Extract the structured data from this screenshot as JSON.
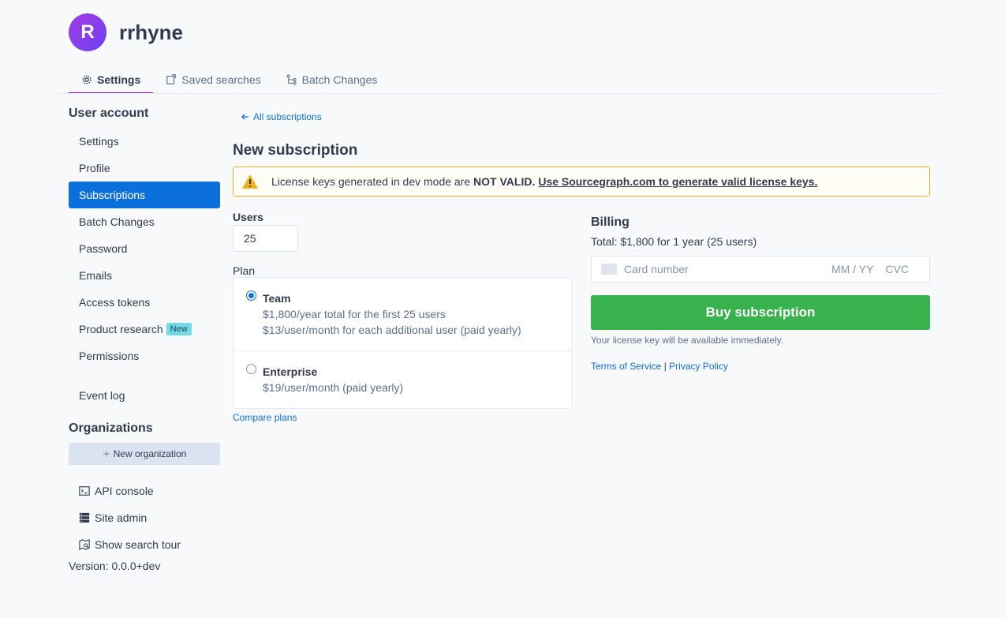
{
  "header": {
    "avatar_initial": "R",
    "username": "rrhyne"
  },
  "tabs": [
    {
      "label": "Settings",
      "icon": "gear-icon",
      "active": true
    },
    {
      "label": "Saved searches",
      "icon": "saved-search-icon"
    },
    {
      "label": "Batch Changes",
      "icon": "batch-changes-icon"
    }
  ],
  "sidebar": {
    "heading": "User account",
    "items": [
      {
        "label": "Settings"
      },
      {
        "label": "Profile"
      },
      {
        "label": "Subscriptions",
        "active": true
      },
      {
        "label": "Batch Changes"
      },
      {
        "label": "Password"
      },
      {
        "label": "Emails"
      },
      {
        "label": "Access tokens"
      },
      {
        "label": "Product research",
        "badge": "New"
      },
      {
        "label": "Permissions"
      },
      {
        "label": "Event log"
      }
    ],
    "orgs_heading": "Organizations",
    "new_org_label": "New organization",
    "bottom_links": [
      {
        "label": "API console",
        "icon": "terminal-icon"
      },
      {
        "label": "Site admin",
        "icon": "server-icon"
      },
      {
        "label": "Show search tour",
        "icon": "map-search-icon"
      }
    ],
    "version": "Version: 0.0.0+dev"
  },
  "main": {
    "back_link": "All subscriptions",
    "title": "New subscription",
    "alert": {
      "text": "License keys generated in dev mode are ",
      "bold": "NOT VALID.",
      "link": "Use Sourcegraph.com to generate valid license keys."
    },
    "users_label": "Users",
    "users_value": "25",
    "plan_label": "Plan",
    "plans": [
      {
        "name": "Team",
        "lines": [
          "$1,800/year total for the first 25 users",
          "$13/user/month for each additional user (paid yearly)"
        ],
        "selected": true
      },
      {
        "name": "Enterprise",
        "lines": [
          "$19/user/month (paid yearly)"
        ],
        "selected": false
      }
    ],
    "compare_link": "Compare plans",
    "billing": {
      "heading": "Billing",
      "total": "Total: $1,800 for 1 year (25 users)",
      "card_placeholder": "Card number",
      "expiry_placeholder": "MM / YY",
      "cvc_placeholder": "CVC",
      "buy_label": "Buy subscription",
      "note": "Your license key will be available immediately.",
      "terms": "Terms of Service",
      "separator": "|",
      "privacy": "Privacy Policy"
    }
  },
  "colors": {
    "accent": "#0b70db",
    "tab_active": "#a305e1",
    "buy": "#37b24d",
    "warning": "#f0b11f"
  }
}
